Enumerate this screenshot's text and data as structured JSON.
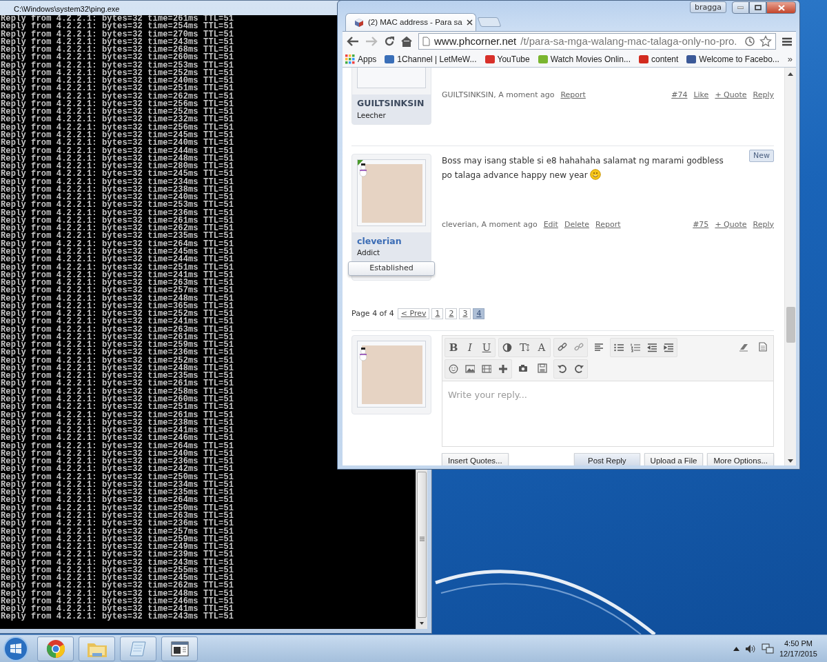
{
  "console_window": {
    "title": "C:\\Windows\\system32\\ping.exe",
    "lines": [
      "Reply from 4.2.2.1: bytes=32 time=261ms TTL=51",
      "Reply from 4.2.2.1: bytes=32 time=254ms TTL=51",
      "Reply from 4.2.2.1: bytes=32 time=270ms TTL=51",
      "Reply from 4.2.2.1: bytes=32 time=243ms TTL=51",
      "Reply from 4.2.2.1: bytes=32 time=268ms TTL=51",
      "Reply from 4.2.2.1: bytes=32 time=260ms TTL=51",
      "Reply from 4.2.2.1: bytes=32 time=253ms TTL=51",
      "Reply from 4.2.2.1: bytes=32 time=252ms TTL=51",
      "Reply from 4.2.2.1: bytes=32 time=240ms TTL=51",
      "Reply from 4.2.2.1: bytes=32 time=251ms TTL=51",
      "Reply from 4.2.2.1: bytes=32 time=262ms TTL=51",
      "Reply from 4.2.2.1: bytes=32 time=256ms TTL=51",
      "Reply from 4.2.2.1: bytes=32 time=252ms TTL=51",
      "Reply from 4.2.2.1: bytes=32 time=232ms TTL=51",
      "Reply from 4.2.2.1: bytes=32 time=256ms TTL=51",
      "Reply from 4.2.2.1: bytes=32 time=245ms TTL=51",
      "Reply from 4.2.2.1: bytes=32 time=240ms TTL=51",
      "Reply from 4.2.2.1: bytes=32 time=244ms TTL=51",
      "Reply from 4.2.2.1: bytes=32 time=248ms TTL=51",
      "Reply from 4.2.2.1: bytes=32 time=280ms TTL=51",
      "Reply from 4.2.2.1: bytes=32 time=245ms TTL=51",
      "Reply from 4.2.2.1: bytes=32 time=234ms TTL=51",
      "Reply from 4.2.2.1: bytes=32 time=238ms TTL=51",
      "Reply from 4.2.2.1: bytes=32 time=240ms TTL=51",
      "Reply from 4.2.2.1: bytes=32 time=253ms TTL=51",
      "Reply from 4.2.2.1: bytes=32 time=236ms TTL=51",
      "Reply from 4.2.2.1: bytes=32 time=261ms TTL=51",
      "Reply from 4.2.2.1: bytes=32 time=262ms TTL=51",
      "Reply from 4.2.2.1: bytes=32 time=235ms TTL=51",
      "Reply from 4.2.2.1: bytes=32 time=264ms TTL=51",
      "Reply from 4.2.2.1: bytes=32 time=245ms TTL=51",
      "Reply from 4.2.2.1: bytes=32 time=244ms TTL=51",
      "Reply from 4.2.2.1: bytes=32 time=251ms TTL=51",
      "Reply from 4.2.2.1: bytes=32 time=241ms TTL=51",
      "Reply from 4.2.2.1: bytes=32 time=263ms TTL=51",
      "Reply from 4.2.2.1: bytes=32 time=257ms TTL=51",
      "Reply from 4.2.2.1: bytes=32 time=248ms TTL=51",
      "Reply from 4.2.2.1: bytes=32 time=365ms TTL=51",
      "Reply from 4.2.2.1: bytes=32 time=252ms TTL=51",
      "Reply from 4.2.2.1: bytes=32 time=241ms TTL=51",
      "Reply from 4.2.2.1: bytes=32 time=263ms TTL=51",
      "Reply from 4.2.2.1: bytes=32 time=261ms TTL=51",
      "Reply from 4.2.2.1: bytes=32 time=259ms TTL=51",
      "Reply from 4.2.2.1: bytes=32 time=236ms TTL=51",
      "Reply from 4.2.2.1: bytes=32 time=252ms TTL=51",
      "Reply from 4.2.2.1: bytes=32 time=248ms TTL=51",
      "Reply from 4.2.2.1: bytes=32 time=235ms TTL=51",
      "Reply from 4.2.2.1: bytes=32 time=261ms TTL=51",
      "Reply from 4.2.2.1: bytes=32 time=258ms TTL=51",
      "Reply from 4.2.2.1: bytes=32 time=260ms TTL=51",
      "Reply from 4.2.2.1: bytes=32 time=251ms TTL=51",
      "Reply from 4.2.2.1: bytes=32 time=261ms TTL=51",
      "Reply from 4.2.2.1: bytes=32 time=238ms TTL=51",
      "Reply from 4.2.2.1: bytes=32 time=241ms TTL=51",
      "Reply from 4.2.2.1: bytes=32 time=246ms TTL=51",
      "Reply from 4.2.2.1: bytes=32 time=264ms TTL=51",
      "Reply from 4.2.2.1: bytes=32 time=240ms TTL=51",
      "Reply from 4.2.2.1: bytes=32 time=236ms TTL=51",
      "Reply from 4.2.2.1: bytes=32 time=242ms TTL=51",
      "Reply from 4.2.2.1: bytes=32 time=250ms TTL=51",
      "Reply from 4.2.2.1: bytes=32 time=234ms TTL=51",
      "Reply from 4.2.2.1: bytes=32 time=235ms TTL=51",
      "Reply from 4.2.2.1: bytes=32 time=264ms TTL=51",
      "Reply from 4.2.2.1: bytes=32 time=250ms TTL=51",
      "Reply from 4.2.2.1: bytes=32 time=263ms TTL=51",
      "Reply from 4.2.2.1: bytes=32 time=236ms TTL=51",
      "Reply from 4.2.2.1: bytes=32 time=257ms TTL=51",
      "Reply from 4.2.2.1: bytes=32 time=259ms TTL=51",
      "Reply from 4.2.2.1: bytes=32 time=249ms TTL=51",
      "Reply from 4.2.2.1: bytes=32 time=239ms TTL=51",
      "Reply from 4.2.2.1: bytes=32 time=243ms TTL=51",
      "Reply from 4.2.2.1: bytes=32 time=255ms TTL=51",
      "Reply from 4.2.2.1: bytes=32 time=245ms TTL=51",
      "Reply from 4.2.2.1: bytes=32 time=262ms TTL=51",
      "Reply from 4.2.2.1: bytes=32 time=248ms TTL=51",
      "Reply from 4.2.2.1: bytes=32 time=246ms TTL=51",
      "Reply from 4.2.2.1: bytes=32 time=241ms TTL=51",
      "Reply from 4.2.2.1: bytes=32 time=243ms TTL=51"
    ]
  },
  "browser": {
    "profile_button": "bragga",
    "tab_title": "(2) MAC address - Para sa",
    "address": {
      "host": "www.phcorner.net",
      "path": "/t/para-sa-mga-walang-mac-talaga-only-no-pro."
    },
    "bookmarks": [
      {
        "kind": "apps",
        "label": "Apps"
      },
      {
        "kind": "site",
        "label": "1Channel | LetMeW...",
        "color": "#3a6fb8"
      },
      {
        "kind": "site",
        "label": "YouTube",
        "color": "#d8302a"
      },
      {
        "kind": "site",
        "label": "Watch Movies Onlin...",
        "color": "#7ab52f"
      },
      {
        "kind": "site",
        "label": "content",
        "color": "#d22b1f"
      },
      {
        "kind": "site",
        "label": "Welcome to Facebo...",
        "color": "#3b5998"
      }
    ],
    "bookmarks_overflow": "»"
  },
  "thread": {
    "posts": [
      {
        "kind": "cut",
        "author": "GUILTSINKSIN",
        "color": "#3d4a5e",
        "rank": "Leecher",
        "byline": "GUILTSINKSIN, A moment ago",
        "actions": [
          "Report"
        ],
        "number": "#74",
        "reply_actions": [
          "Like",
          "+ Quote",
          "Reply"
        ]
      },
      {
        "kind": "photo",
        "author": "cleverian",
        "color": "#3b6cb5",
        "rank": "Addict",
        "banner": "Established",
        "badge": "New",
        "message": "Boss may isang stable si e8 hahahaha salamat ng marami godbless po talaga advance happy new year",
        "smiley": true,
        "byline": "cleverian, A moment ago",
        "actions": [
          "Edit",
          "Delete",
          "Report"
        ],
        "number": "#75",
        "reply_actions": [
          "+ Quote",
          "Reply"
        ]
      }
    ],
    "pagination": {
      "label": "Page 4 of 4",
      "prev": "< Prev",
      "pages": [
        {
          "label": "1",
          "selected": false
        },
        {
          "label": "2",
          "selected": false
        },
        {
          "label": "3",
          "selected": false
        },
        {
          "label": "4",
          "selected": true
        }
      ]
    },
    "editor": {
      "text_buttons": [
        "B",
        "I",
        "U",
        "T",
        "A"
      ],
      "placeholder": "Write your reply...",
      "left_buttons": [
        {
          "label": "Insert Quotes...",
          "primary": false
        }
      ],
      "right_buttons": [
        {
          "label": "Post Reply",
          "primary": true
        },
        {
          "label": "Upload a File",
          "primary": false
        },
        {
          "label": "More Options...",
          "primary": false
        }
      ]
    }
  },
  "taskbar": {
    "time": "4:50 PM",
    "date": "12/17/2015"
  }
}
